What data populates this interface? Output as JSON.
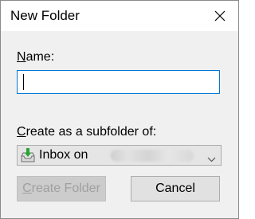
{
  "window": {
    "title": "New Folder",
    "close_icon": "close-icon"
  },
  "name_field": {
    "label_access_key": "N",
    "label_rest": "ame:",
    "value": ""
  },
  "subfolder": {
    "label_access_key": "C",
    "label_rest": "reate as a subfolder of:",
    "selected_prefix": "Inbox on",
    "icon": "inbox-icon",
    "chevron_icon": "chevron-down-icon"
  },
  "buttons": {
    "create_access_key": "C",
    "create_rest": "reate Folder",
    "create_enabled": false,
    "cancel": "Cancel"
  },
  "colors": {
    "focus_border": "#0078d7",
    "dialog_background": "#f0f0f0",
    "inbox_arrow": "#2aa43a",
    "disabled_text": "#a0a0a0"
  }
}
